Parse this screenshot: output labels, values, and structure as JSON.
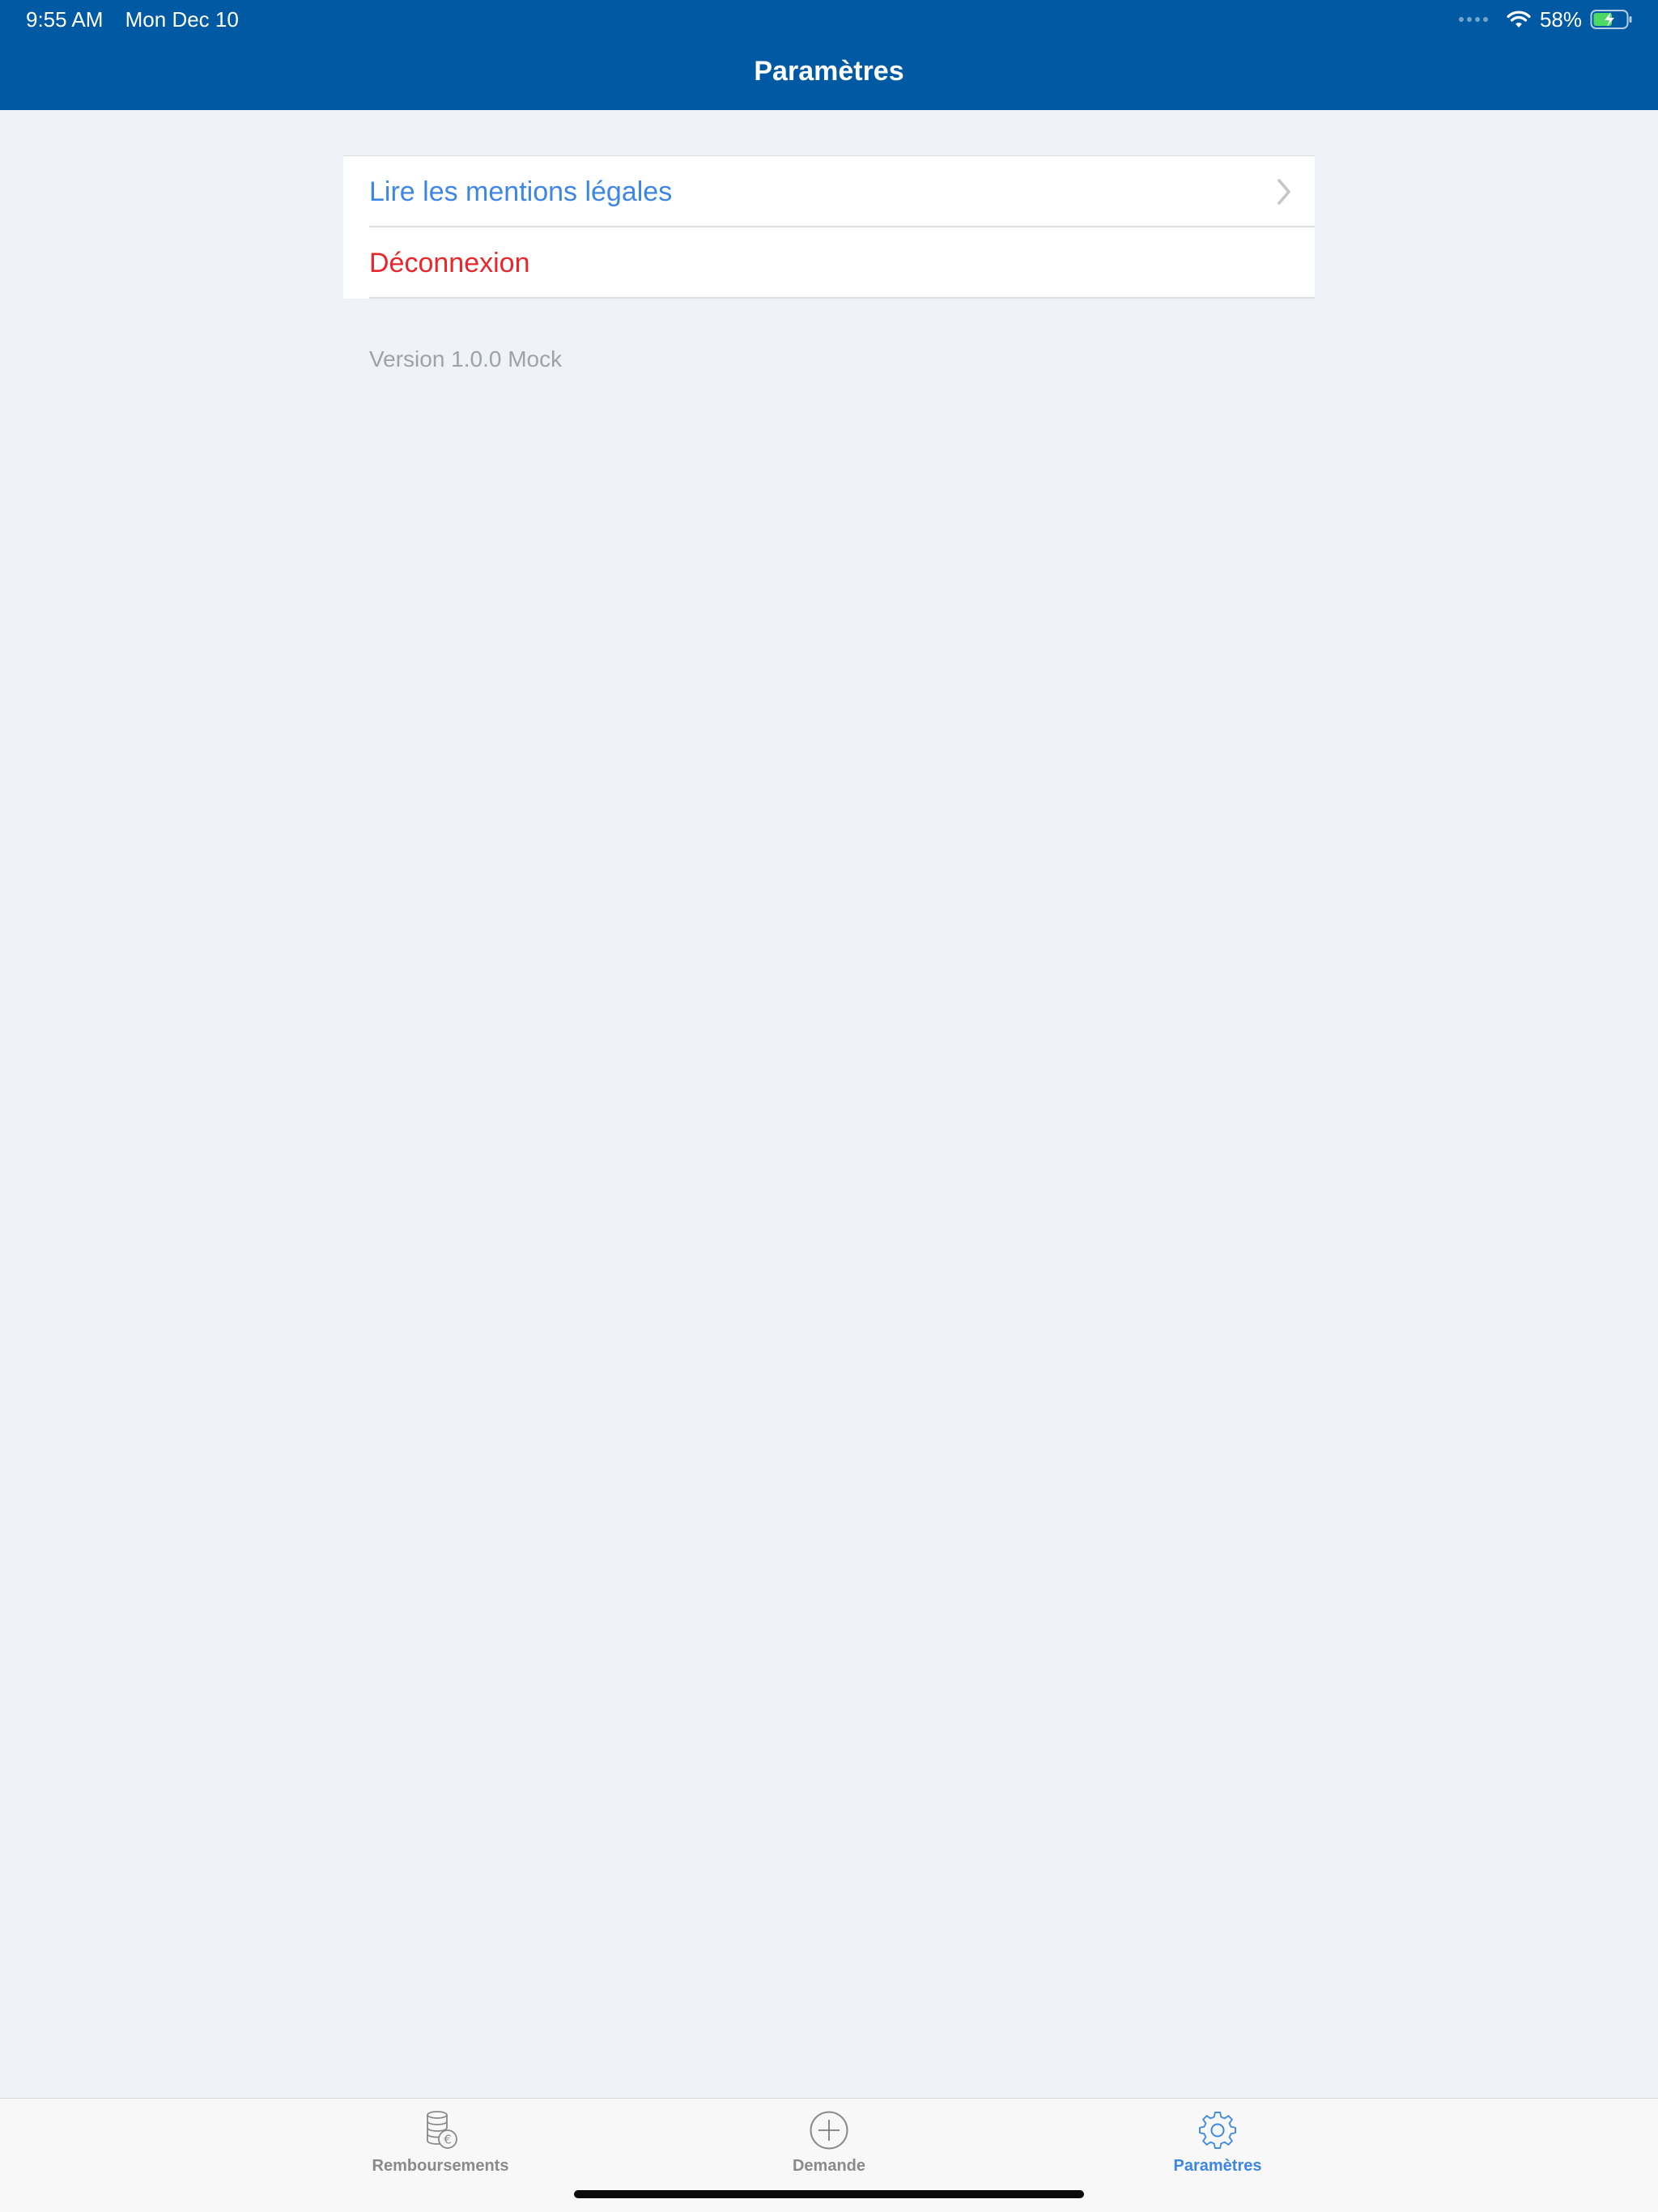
{
  "status_bar": {
    "time": "9:55 AM",
    "date": "Mon Dec 10",
    "battery_percent": "58%",
    "battery_level": 0.58
  },
  "nav": {
    "title": "Paramètres"
  },
  "settings": {
    "legal_label": "Lire les mentions légales",
    "logout_label": "Déconnexion",
    "version_text": "Version 1.0.0 Mock"
  },
  "tabs": [
    {
      "label": "Remboursements",
      "icon": "coins-euro-icon",
      "active": false
    },
    {
      "label": "Demande",
      "icon": "plus-circle-icon",
      "active": false
    },
    {
      "label": "Paramètres",
      "icon": "gear-icon",
      "active": true
    }
  ],
  "colors": {
    "header": "#005aa3",
    "accent": "#3d86e6",
    "danger": "#e8262b",
    "background": "#eff2f7"
  }
}
